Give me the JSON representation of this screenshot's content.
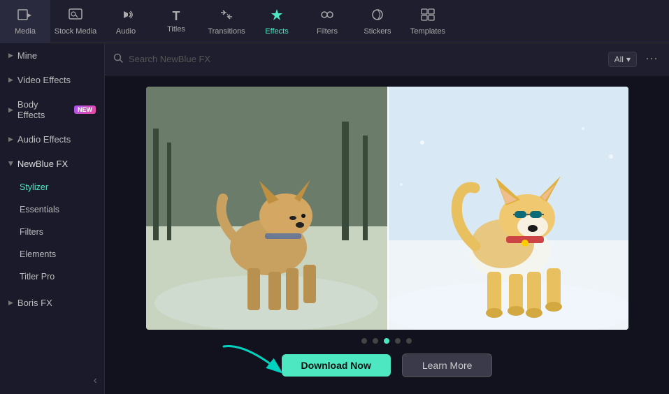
{
  "toolbar": {
    "items": [
      {
        "id": "media",
        "label": "Media",
        "icon": "🎞",
        "active": false
      },
      {
        "id": "stock-media",
        "label": "Stock Media",
        "icon": "📷",
        "active": false
      },
      {
        "id": "audio",
        "label": "Audio",
        "icon": "🎵",
        "active": false
      },
      {
        "id": "titles",
        "label": "Titles",
        "icon": "T",
        "active": false
      },
      {
        "id": "transitions",
        "label": "Transitions",
        "icon": "⇄",
        "active": false
      },
      {
        "id": "effects",
        "label": "Effects",
        "icon": "✦",
        "active": true
      },
      {
        "id": "filters",
        "label": "Filters",
        "icon": "◈",
        "active": false
      },
      {
        "id": "stickers",
        "label": "Stickers",
        "icon": "🎯",
        "active": false
      },
      {
        "id": "templates",
        "label": "Templates",
        "icon": "▦",
        "active": false
      }
    ]
  },
  "sidebar": {
    "items": [
      {
        "id": "mine",
        "label": "Mine",
        "type": "group",
        "expanded": false
      },
      {
        "id": "video-effects",
        "label": "Video Effects",
        "type": "group",
        "expanded": false
      },
      {
        "id": "body-effects",
        "label": "Body Effects",
        "type": "group",
        "badge": "NEW",
        "expanded": false
      },
      {
        "id": "audio-effects",
        "label": "Audio Effects",
        "type": "group",
        "expanded": false
      },
      {
        "id": "newblue-fx",
        "label": "NewBlue FX",
        "type": "group",
        "expanded": true
      }
    ],
    "newblue_sub": [
      {
        "id": "stylizer",
        "label": "Stylizer",
        "active": true
      },
      {
        "id": "essentials",
        "label": "Essentials",
        "active": false
      },
      {
        "id": "filters",
        "label": "Filters",
        "active": false
      },
      {
        "id": "elements",
        "label": "Elements",
        "active": false
      },
      {
        "id": "titler-pro",
        "label": "Titler Pro",
        "active": false
      }
    ],
    "bottom_groups": [
      {
        "id": "boris-fx",
        "label": "Boris FX",
        "type": "group",
        "expanded": false
      }
    ],
    "collapse_label": "‹"
  },
  "search": {
    "placeholder": "Search NewBlue FX",
    "filter_label": "All",
    "more_icon": "⋯"
  },
  "preview": {
    "dots": [
      false,
      false,
      true,
      false,
      false
    ],
    "download_label": "Download Now",
    "learn_label": "Learn More"
  }
}
